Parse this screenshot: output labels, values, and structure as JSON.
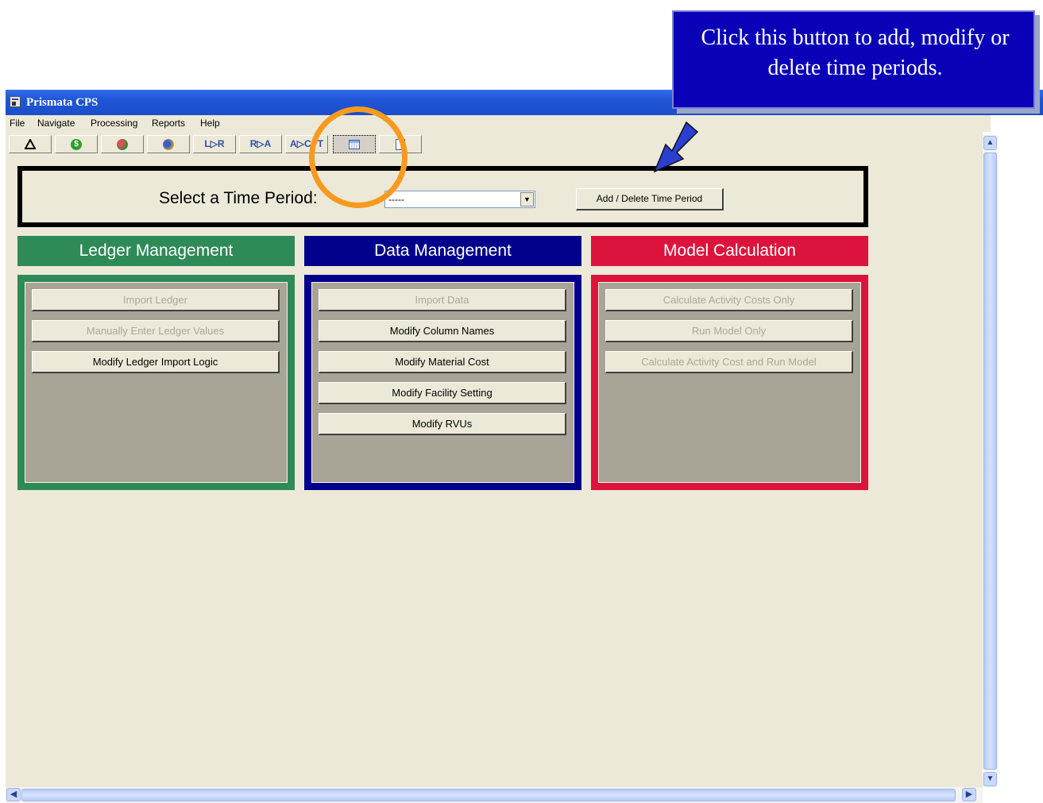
{
  "callout": {
    "text": "Click this button to add, modify or delete time periods."
  },
  "window": {
    "title": "Prismata CPS"
  },
  "menu": [
    "File",
    "Navigate",
    "Processing",
    "Reports",
    "Help"
  ],
  "toolbar": {
    "btn_lr": "L▷R",
    "btn_ra": "R▷A",
    "btn_acpt": "A▷CPT"
  },
  "time_period": {
    "label": "Select a Time Period:",
    "selected_value": "-----",
    "add_button": "Add / Delete Time Period"
  },
  "sections": {
    "ledger": {
      "title": "Ledger Management",
      "color": "#2e8a57",
      "buttons": [
        "Import Ledger",
        "Manually Enter Ledger Values",
        "Modify Ledger Import Logic"
      ]
    },
    "data": {
      "title": "Data Management",
      "color": "#00008b",
      "buttons": [
        "Import Data",
        "Modify Column Names",
        "Modify Material Cost",
        "Modify Facility Setting",
        "Modify RVUs"
      ]
    },
    "model": {
      "title": "Model Calculation",
      "color": "#dc143c",
      "buttons": [
        "Calculate Activity Costs Only",
        "Run Model Only",
        "Calculate Activity Cost and Run Model"
      ]
    }
  }
}
